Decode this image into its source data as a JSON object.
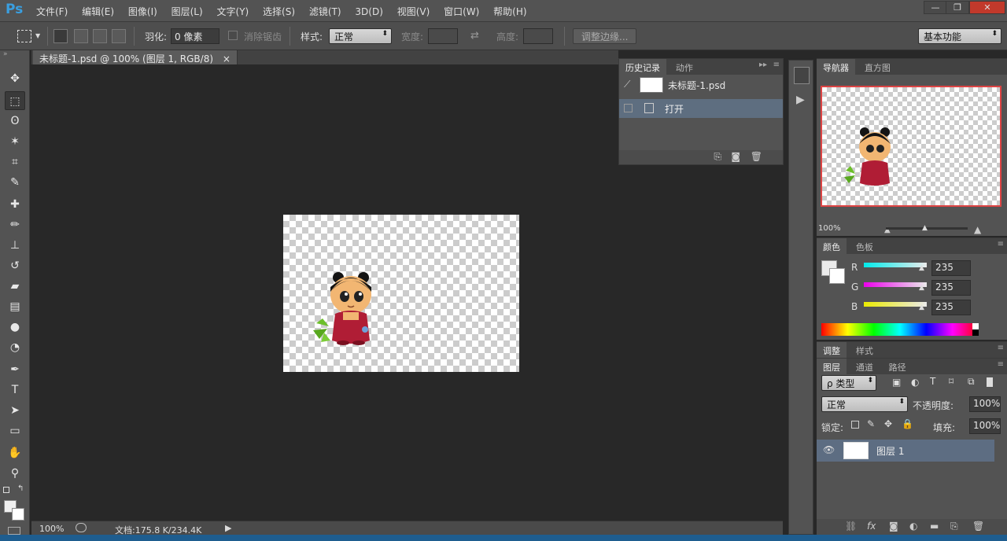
{
  "app": {
    "logo": "Ps"
  },
  "menu": [
    "文件(F)",
    "编辑(E)",
    "图像(I)",
    "图层(L)",
    "文字(Y)",
    "选择(S)",
    "滤镜(T)",
    "3D(D)",
    "视图(V)",
    "窗口(W)",
    "帮助(H)"
  ],
  "window_controls": {
    "minimize": "—",
    "restore": "❐",
    "close": "✕"
  },
  "options": {
    "feather_label": "羽化:",
    "feather_value": "0 像素",
    "antialias_label": "消除锯齿",
    "style_label": "样式:",
    "style_value": "正常",
    "width_label": "宽度:",
    "height_label": "高度:",
    "refine_edge": "调整边缘...",
    "workspace": "基本功能"
  },
  "document": {
    "tab_title": "未标题-1.psd @ 100% (图层 1, RGB/8)",
    "tab_close": "×",
    "zoom": "100%",
    "doc_info": "文档:175.8 K/234.4K"
  },
  "history_panel": {
    "tabs": [
      "历史记录",
      "动作"
    ],
    "snapshot_name": "未标题-1.psd",
    "steps": [
      "打开"
    ]
  },
  "navigator": {
    "tabs": [
      "导航器",
      "直方图"
    ],
    "zoom": "100%"
  },
  "color_panel": {
    "tabs": [
      "颜色",
      "色板"
    ],
    "channels": [
      {
        "label": "R",
        "value": "235"
      },
      {
        "label": "G",
        "value": "235"
      },
      {
        "label": "B",
        "value": "235"
      }
    ]
  },
  "adjustments": {
    "tabs": [
      "调整",
      "样式"
    ]
  },
  "layers_panel": {
    "tabs": [
      "图层",
      "通道",
      "路径"
    ],
    "filter_kind": "ρ 类型",
    "blend_mode": "正常",
    "opacity_label": "不透明度:",
    "opacity_value": "100%",
    "lock_label": "锁定:",
    "fill_label": "填充:",
    "fill_value": "100%",
    "layers": [
      {
        "name": "图层 1"
      }
    ]
  },
  "tools": [
    {
      "name": "move-tool",
      "glyph": "✥"
    },
    {
      "name": "marquee-tool",
      "glyph": "⬚"
    },
    {
      "name": "lasso-tool",
      "glyph": "ʘ"
    },
    {
      "name": "magic-wand-tool",
      "glyph": "✶"
    },
    {
      "name": "crop-tool",
      "glyph": "⌗"
    },
    {
      "name": "eyedropper-tool",
      "glyph": "✎"
    },
    {
      "name": "healing-brush-tool",
      "glyph": "✚"
    },
    {
      "name": "brush-tool",
      "glyph": "✏"
    },
    {
      "name": "clone-stamp-tool",
      "glyph": "⊥"
    },
    {
      "name": "history-brush-tool",
      "glyph": "↺"
    },
    {
      "name": "eraser-tool",
      "glyph": "▰"
    },
    {
      "name": "gradient-tool",
      "glyph": "▤"
    },
    {
      "name": "blur-tool",
      "glyph": "●"
    },
    {
      "name": "dodge-tool",
      "glyph": "◔"
    },
    {
      "name": "pen-tool",
      "glyph": "✒"
    },
    {
      "name": "type-tool",
      "glyph": "T"
    },
    {
      "name": "path-select-tool",
      "glyph": "➤"
    },
    {
      "name": "rectangle-tool",
      "glyph": "▭"
    },
    {
      "name": "hand-tool",
      "glyph": "✋"
    },
    {
      "name": "zoom-tool",
      "glyph": "⚲"
    }
  ]
}
